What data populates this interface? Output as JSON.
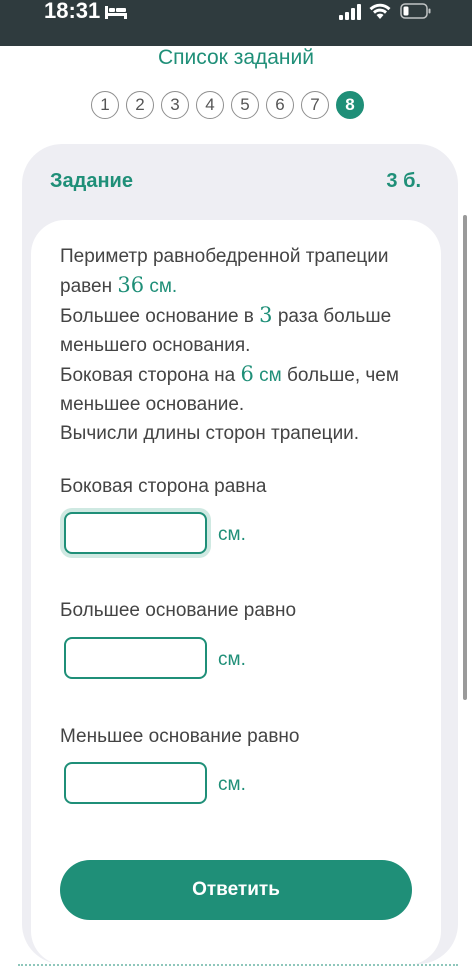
{
  "status_bar": {
    "time": "18:31"
  },
  "header": {
    "title": "Список заданий"
  },
  "pager": {
    "pages": [
      "1",
      "2",
      "3",
      "4",
      "5",
      "6",
      "7",
      "8"
    ],
    "active_index": 7
  },
  "task": {
    "label": "Задание",
    "points": "3 б."
  },
  "problem": {
    "p1": "Периметр равнобедренной трапеции равен ",
    "perimeter": "36",
    "p1_unit": " см.",
    "p2": "Большее основание в ",
    "ratio": "3",
    "p2_end": " раза больше меньшего основания.",
    "p3": "Боковая сторона на ",
    "diff": "6",
    "p3_unit": " см",
    "p3_end": " больше, чем меньшее основание.",
    "p4": "Вычисли длины сторон трапеции."
  },
  "fields": [
    {
      "label": "Боковая сторона равна",
      "value": "",
      "unit": "см."
    },
    {
      "label": "Большее основание равно",
      "value": "",
      "unit": "см."
    },
    {
      "label": "Меньшее основание равно",
      "value": "",
      "unit": "см."
    }
  ],
  "submit_label": "Ответить",
  "colors": {
    "accent": "#1f8f78",
    "statusbar": "#2f3b3e",
    "panel": "#eeeef3"
  }
}
